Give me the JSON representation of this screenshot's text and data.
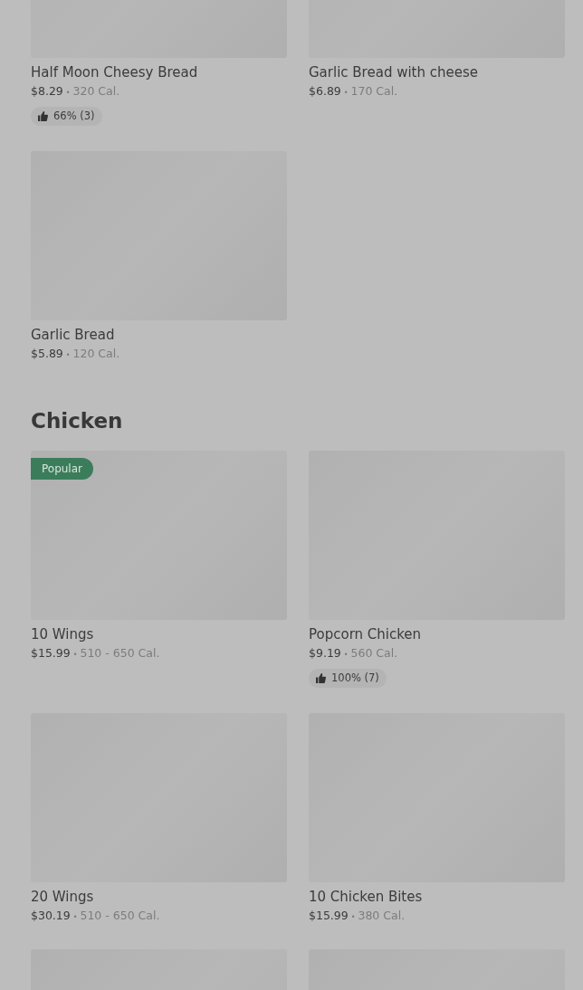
{
  "sections": [
    {
      "items": [
        {
          "kind": "card",
          "name": "Half Moon Cheesy Bread",
          "price": "$8.29",
          "separator": "•",
          "calories": "320 Cal.",
          "rating": "66% (3)"
        },
        {
          "kind": "card",
          "name": "Garlic Bread with cheese",
          "price": "$6.89",
          "separator": "•",
          "calories": "170 Cal."
        },
        {
          "kind": "card",
          "name": "Garlic Bread",
          "price": "$5.89",
          "separator": "•",
          "calories": "120 Cal."
        }
      ]
    },
    {
      "heading": "Chicken",
      "items": [
        {
          "kind": "card",
          "name": "10 Wings",
          "price": "$15.99",
          "separator": "•",
          "calories": "510 - 650 Cal.",
          "badge": "Popular"
        },
        {
          "kind": "card",
          "name": "Popcorn Chicken",
          "price": "$9.19",
          "separator": "•",
          "calories": "560 Cal.",
          "rating": "100% (7)"
        },
        {
          "kind": "card",
          "name": "20 Wings",
          "price": "$30.19",
          "separator": "•",
          "calories": "510 - 650 Cal."
        },
        {
          "kind": "card",
          "name": "10 Chicken Bites",
          "price": "$15.99",
          "separator": "•",
          "calories": "380 Cal."
        },
        {
          "kind": "image_only"
        },
        {
          "kind": "image_only"
        }
      ]
    }
  ]
}
